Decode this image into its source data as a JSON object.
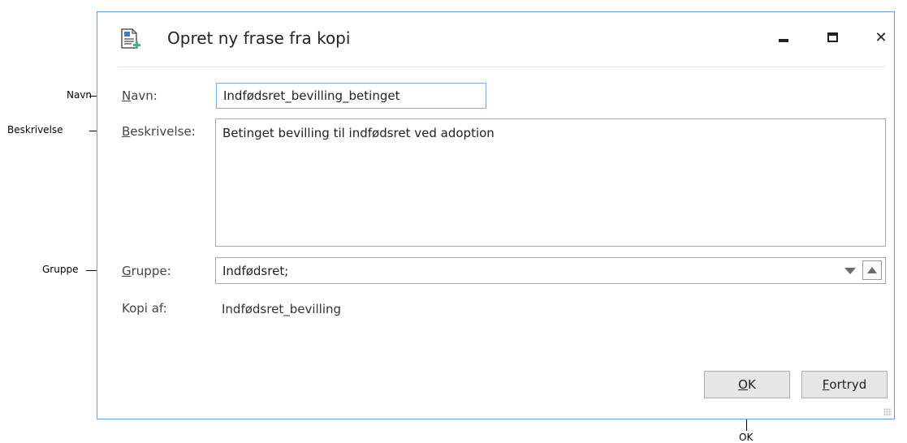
{
  "callouts": {
    "navn": "Navn",
    "beskrivelse": "Beskrivelse",
    "gruppe": "Gruppe",
    "ok": "OK"
  },
  "dialog": {
    "title": "Opret ny frase fra kopi",
    "close_glyph": "✕",
    "labels": {
      "name_pre": "",
      "name_u": "N",
      "name_post": "avn:",
      "desc_u": "B",
      "desc_post": "eskrivelse:",
      "group_u": "G",
      "group_post": "ruppe:",
      "copy_of": "Kopi af:"
    },
    "values": {
      "name": "Indfødsret_bevilling_betinget",
      "description": "Betinget bevilling til indfødsret ved adoption",
      "group": "Indfødsret;",
      "copy_of": "Indfødsret_bevilling"
    },
    "buttons": {
      "ok_u": "O",
      "ok_post": "K",
      "cancel_u": "F",
      "cancel_post": "ortryd"
    }
  },
  "icons": [
    "document-add-icon",
    "minimize-icon",
    "maximize-icon",
    "close-icon",
    "dropdown-arrow-icon",
    "up-arrow-icon",
    "resize-grip-icon"
  ],
  "colors": {
    "dialog_border": "#6a9fd4",
    "focus_border": "#7eb0e2",
    "button_bg": "#e6e6e6",
    "icon_accent": "#4caf7d"
  }
}
